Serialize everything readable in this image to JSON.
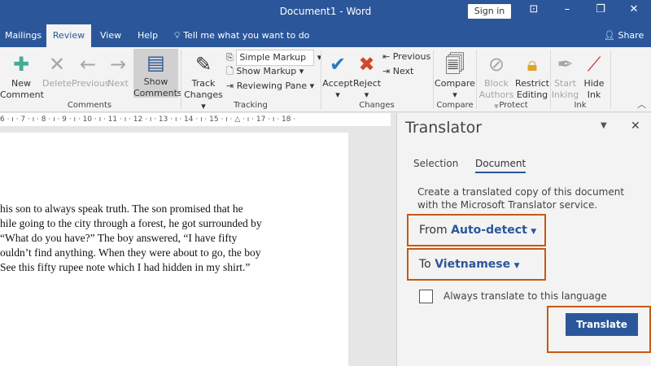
{
  "title": "Document1  -  Word",
  "sign_in": "Sign in",
  "share": "Share",
  "tabs": [
    "Mailings",
    "Review",
    "View",
    "Help"
  ],
  "tell_me": "Tell me what you want to do",
  "ribbon": {
    "new_comment": [
      "New",
      "Comment"
    ],
    "delete": "Delete",
    "previous": "Previous",
    "next": "Next",
    "show_comments": [
      "Show",
      "Comments"
    ],
    "track_changes": [
      "Track",
      "Changes"
    ],
    "markup_select": "Simple Markup",
    "show_markup": "Show Markup",
    "reviewing_pane": "Reviewing Pane",
    "accept": "Accept",
    "reject": "Reject",
    "prev_change": "Previous",
    "next_change": "Next",
    "compare": "Compare",
    "block_authors": [
      "Block",
      "Authors"
    ],
    "restrict_editing": [
      "Restrict",
      "Editing"
    ],
    "start_inking": [
      "Start",
      "Inking"
    ],
    "hide_ink": [
      "Hide",
      "Ink"
    ],
    "groups": {
      "comments": "Comments",
      "tracking": "Tracking",
      "changes": "Changes",
      "compare": "Compare",
      "protect": "Protect",
      "ink": "Ink"
    }
  },
  "ruler": "6 · ı · 7 · ı · 8 · ı · 9 · ı · 10 · ı · 11 · ı · 12 · ı · 13 · ı · 14 · ı · 15 · ı · △ · ı · 17 · ı · 18 ·",
  "document_lines": [
    "his son to always speak truth. The son promised that he",
    "hile going to the city through a forest, he got surrounded by",
    " “What do you have?” The boy answered, “I have fifty",
    "ouldn’t find anything. When they were about to go, the boy",
    "See this fifty rupee note which I had hidden in my shirt.”"
  ],
  "translator": {
    "title": "Translator",
    "tabs": [
      "Selection",
      "Document"
    ],
    "active_tab": "Document",
    "description": "Create a translated copy of this document with the Microsoft Translator service.",
    "from_label": "From",
    "from_value": "Auto-detect",
    "to_label": "To",
    "to_value": "Vietnamese",
    "always_translate": "Always translate to this language",
    "always_translate_checked": false,
    "translate_button": "Translate"
  },
  "colors": {
    "brand": "#2b579a",
    "highlight": "#c55a11"
  }
}
